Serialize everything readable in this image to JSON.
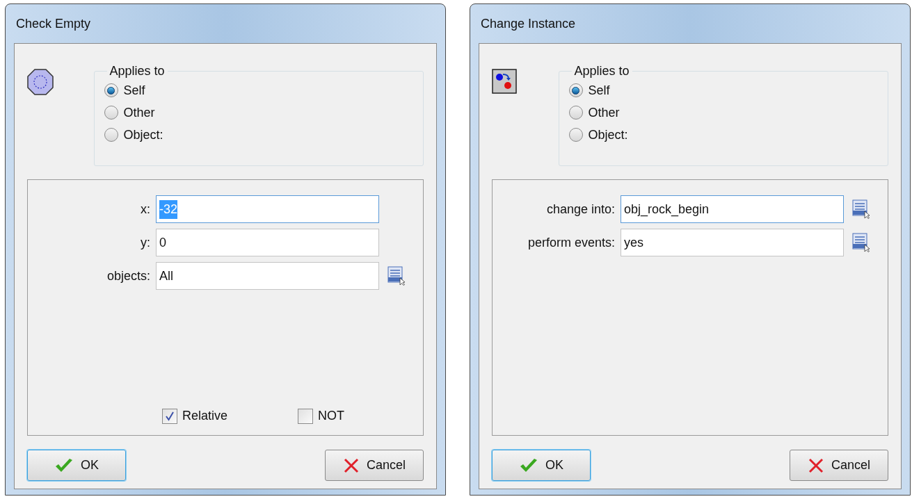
{
  "dialogs": [
    {
      "title": "Check Empty",
      "applies_to": {
        "legend": "Applies to",
        "options": [
          {
            "label": "Self",
            "selected": true
          },
          {
            "label": "Other",
            "selected": false
          },
          {
            "label": "Object:",
            "selected": false
          }
        ]
      },
      "fields": [
        {
          "label": "x:",
          "value": "-32",
          "focused": true,
          "text_selected": true,
          "picker": false
        },
        {
          "label": "y:",
          "value": "0",
          "focused": false,
          "text_selected": false,
          "picker": false
        },
        {
          "label": "objects:",
          "value": "All",
          "focused": false,
          "text_selected": false,
          "picker": true
        }
      ],
      "checkboxes": [
        {
          "label": "Relative",
          "checked": true
        },
        {
          "label": "NOT",
          "checked": false
        }
      ],
      "buttons": [
        {
          "label": "OK",
          "kind": "ok",
          "focused": true
        },
        {
          "label": "Cancel",
          "kind": "cancel",
          "focused": false
        }
      ]
    },
    {
      "title": "Change Instance",
      "applies_to": {
        "legend": "Applies to",
        "options": [
          {
            "label": "Self",
            "selected": true
          },
          {
            "label": "Other",
            "selected": false
          },
          {
            "label": "Object:",
            "selected": false
          }
        ]
      },
      "fields": [
        {
          "label": "change into:",
          "value": "obj_rock_begin",
          "focused": true,
          "text_selected": false,
          "picker": true
        },
        {
          "label": "perform events:",
          "value": "yes",
          "focused": false,
          "text_selected": false,
          "picker": true
        }
      ],
      "buttons": [
        {
          "label": "OK",
          "kind": "ok",
          "focused": true
        },
        {
          "label": "Cancel",
          "kind": "cancel",
          "focused": false
        }
      ]
    }
  ]
}
